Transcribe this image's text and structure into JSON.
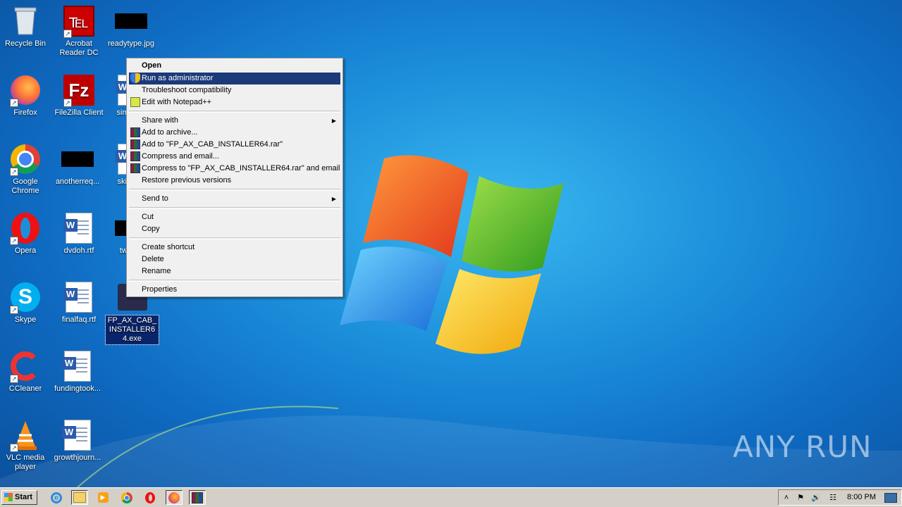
{
  "desktop_icons": [
    {
      "label": "Recycle Bin"
    },
    {
      "label": "Acrobat Reader DC"
    },
    {
      "label": "readytype.jpg"
    },
    {
      "label": "Firefox"
    },
    {
      "label": "FileZilla Client"
    },
    {
      "label": "simple..."
    },
    {
      "label": "Google Chrome"
    },
    {
      "label": "anotherreq..."
    },
    {
      "label": "skillsa..."
    },
    {
      "label": "Opera"
    },
    {
      "label": "dvdoh.rtf"
    },
    {
      "label": "twoh..."
    },
    {
      "label": "Skype"
    },
    {
      "label": "finalfaq.rtf"
    },
    {
      "label": "FP_AX_CAB_INSTALLER64.exe"
    },
    {
      "label": "CCleaner"
    },
    {
      "label": "fundingtook..."
    },
    {
      "label": "VLC media player"
    },
    {
      "label": "growthjourn..."
    }
  ],
  "context_menu": {
    "items": [
      {
        "label": "Open"
      },
      {
        "label": "Run as administrator"
      },
      {
        "label": "Troubleshoot compatibility"
      },
      {
        "label": "Edit with Notepad++"
      },
      {
        "label": "Share with"
      },
      {
        "label": "Add to archive..."
      },
      {
        "label": "Add to \"FP_AX_CAB_INSTALLER64.rar\""
      },
      {
        "label": "Compress and email..."
      },
      {
        "label": "Compress to \"FP_AX_CAB_INSTALLER64.rar\" and email"
      },
      {
        "label": "Restore previous versions"
      },
      {
        "label": "Send to"
      },
      {
        "label": "Cut"
      },
      {
        "label": "Copy"
      },
      {
        "label": "Create shortcut"
      },
      {
        "label": "Delete"
      },
      {
        "label": "Rename"
      },
      {
        "label": "Properties"
      }
    ],
    "highlighted": "Run as administrator",
    "highlight_color": "#1a3a7a"
  },
  "taskbar": {
    "start_label": "Start",
    "pinned": [
      "ie-icon",
      "explorer-icon",
      "media-player-icon",
      "chrome-icon",
      "opera-icon",
      "firefox-icon",
      "winrar-icon"
    ],
    "clock": "8:00 PM"
  },
  "watermark": "ANY RUN"
}
